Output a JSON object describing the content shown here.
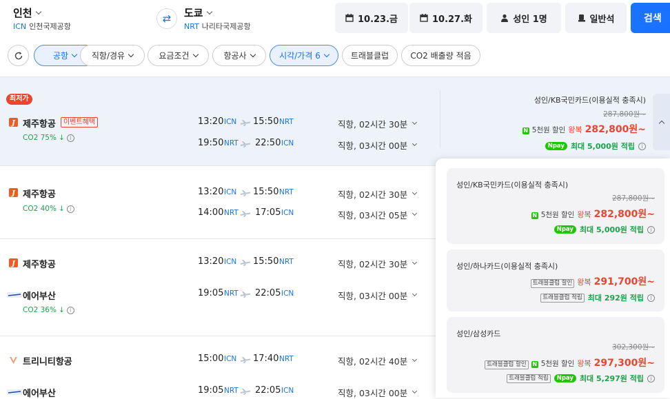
{
  "header": {
    "origin": {
      "city": "인천",
      "code": "ICN",
      "airport": "인천국제공항"
    },
    "destination": {
      "city": "도쿄",
      "code": "NRT",
      "airport": "나리타국제공항"
    },
    "depart_date": "10.23.금",
    "return_date": "10.27.화",
    "passengers": "성인 1명",
    "cabin": "일반석",
    "search_label": "검색"
  },
  "filters": [
    "공항",
    "직항/경유",
    "요금조건",
    "항공사",
    "시각/가격 6",
    "트래블클럽",
    "CO2 배출량 적음"
  ],
  "active_filters": [
    "공항",
    "시각/가격 6"
  ],
  "results": [
    {
      "badge": "최저가",
      "airline": "제주항공",
      "event_tag": "이벤트혜택",
      "co2": "CO2 75%",
      "legs": [
        {
          "dep_time": "13:20",
          "dep_ap": "ICN",
          "arr_time": "15:50",
          "arr_ap": "NRT",
          "duration": "직항, 02시간 30분"
        },
        {
          "dep_time": "19:50",
          "dep_ap": "NRT",
          "arr_time": "22:50",
          "arr_ap": "ICN",
          "duration": "직항, 03시간 00분"
        }
      ],
      "price": {
        "title": "성인/KB국민카드(이용실적 충족시)",
        "original": "287,800원~",
        "discount": "5천원 할인",
        "roundtrip": "왕복",
        "amount": "282,800원~",
        "points": "최대 5,000원 적립"
      }
    },
    {
      "airline": "제주항공",
      "co2": "CO2 40%",
      "legs": [
        {
          "dep_time": "13:20",
          "dep_ap": "ICN",
          "arr_time": "15:50",
          "arr_ap": "NRT",
          "duration": "직항, 02시간 30분"
        },
        {
          "dep_time": "14:00",
          "dep_ap": "NRT",
          "arr_time": "17:05",
          "arr_ap": "ICN",
          "duration": "직항, 03시간 05분"
        }
      ]
    },
    {
      "airline": "제주항공",
      "airline2": "에어부산",
      "co2": "CO2 36%",
      "legs": [
        {
          "dep_time": "13:20",
          "dep_ap": "ICN",
          "arr_time": "15:50",
          "arr_ap": "NRT",
          "duration": "직항, 02시간 30분"
        },
        {
          "dep_time": "19:05",
          "dep_ap": "NRT",
          "arr_time": "22:05",
          "arr_ap": "ICN",
          "duration": "직항, 03시간 00분"
        }
      ]
    },
    {
      "airline": "트리니티항공",
      "airline2": "에어부산",
      "legs": [
        {
          "dep_time": "15:00",
          "dep_ap": "ICN",
          "arr_time": "17:40",
          "arr_ap": "NRT",
          "duration": "직항, 02시간 40분"
        },
        {
          "dep_time": "19:05",
          "dep_ap": "NRT",
          "arr_time": "22:05",
          "arr_ap": "ICN",
          "duration": "직항, 03시간 00분"
        }
      ]
    }
  ],
  "price_panel": [
    {
      "title": "성인/KB국민카드(이용실적 충족시)",
      "original": "287,800원~",
      "discount": "5천원 할인",
      "roundtrip": "왕복",
      "amount": "282,800원~",
      "points": "최대 5,000원 적립"
    },
    {
      "title": "성인/하나카드(이용실적 충족시)",
      "tag1": "트래블클럽 할인",
      "roundtrip": "왕복",
      "amount": "291,700원~",
      "tag2": "트래블클럽 적립",
      "points": "최대 292원 적립"
    },
    {
      "title": "성인/삼성카드",
      "original": "302,300원~",
      "tag1": "트래블클럽 할인",
      "discount": "5천원 할인",
      "roundtrip": "왕복",
      "amount": "297,300원~",
      "tag2": "트래블클럽 적립",
      "points": "최대 5,297원 적립"
    }
  ],
  "npay_label": "pay",
  "colors": {
    "accent": "#1a73ff",
    "price_red": "#e8462f",
    "co2_green": "#1aa34a",
    "naver_green": "#1ec800"
  }
}
